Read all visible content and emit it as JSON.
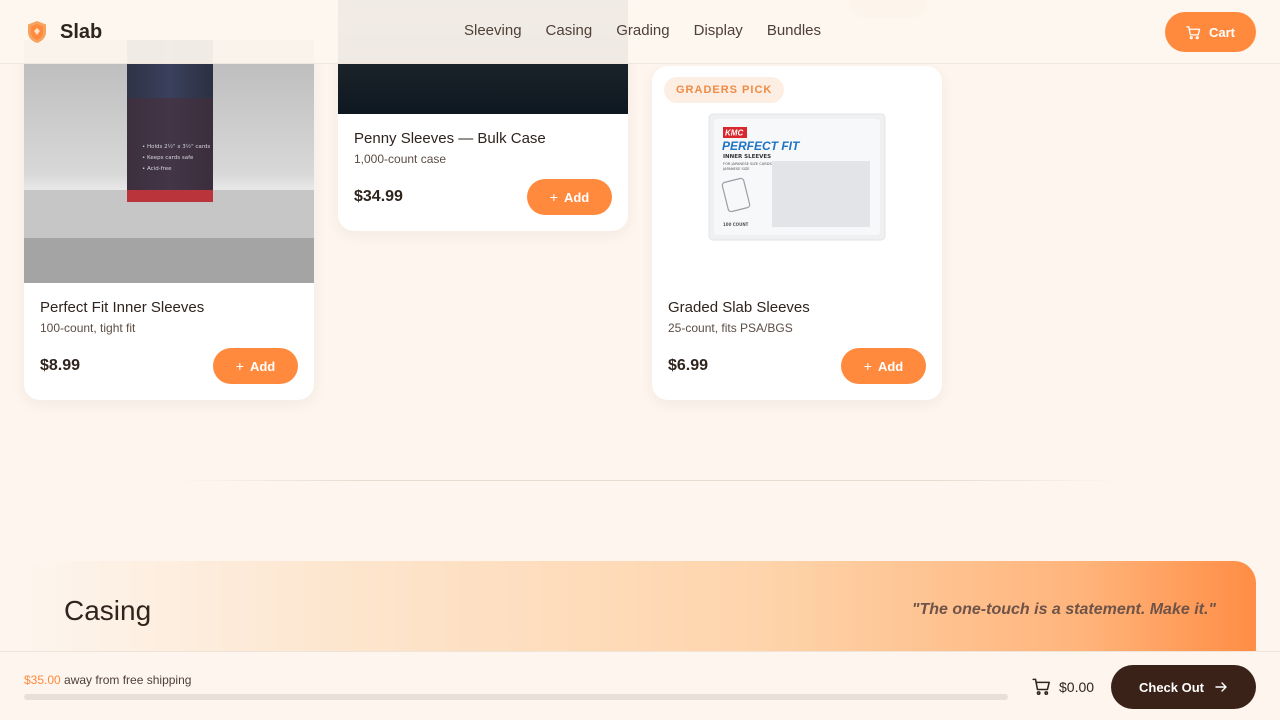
{
  "brand": {
    "name": "Slab"
  },
  "nav": {
    "items": [
      "Sleeving",
      "Casing",
      "Grading",
      "Display",
      "Bundles"
    ]
  },
  "header": {
    "cart_label": "Cart"
  },
  "products": [
    {
      "title": "Perfect Fit Inner Sleeves",
      "subtitle": "100-count, tight fit",
      "price": "$8.99",
      "add_label": "Add"
    },
    {
      "title": "Penny Sleeves — Bulk Case",
      "subtitle": "1,000-count case",
      "price": "$34.99",
      "add_label": "Add"
    },
    {
      "title": "Graded Slab Sleeves",
      "subtitle": "25-count, fits PSA/BGS",
      "price": "$6.99",
      "add_label": "Add",
      "badge": "GRADERS PICK"
    }
  ],
  "package_art": {
    "bag1_lines": [
      "• Holds 2½\" x 3½\" cards",
      "• Keeps cards safe",
      "• Acid-free"
    ],
    "kmc_logo": "KMC",
    "kmc_title": "PERFECT FIT",
    "kmc_subtitle": "INNER SLEEVES",
    "kmc_small": [
      "FOR JAPANESE SIZE CARDS",
      "JAPANESE SIZE"
    ],
    "kmc_count": "100 COUNT"
  },
  "section": {
    "title": "Casing",
    "quote": "\"The one-touch is a statement. Make it.\""
  },
  "shipping": {
    "amount": "$35.00",
    "message": " away from free shipping",
    "progress": 0
  },
  "cart_bar": {
    "total": "$0.00",
    "checkout_label": "Check Out"
  },
  "colors": {
    "accent": "#ff8a3d",
    "dark": "#3a2219",
    "background": "#fdf5ee"
  }
}
